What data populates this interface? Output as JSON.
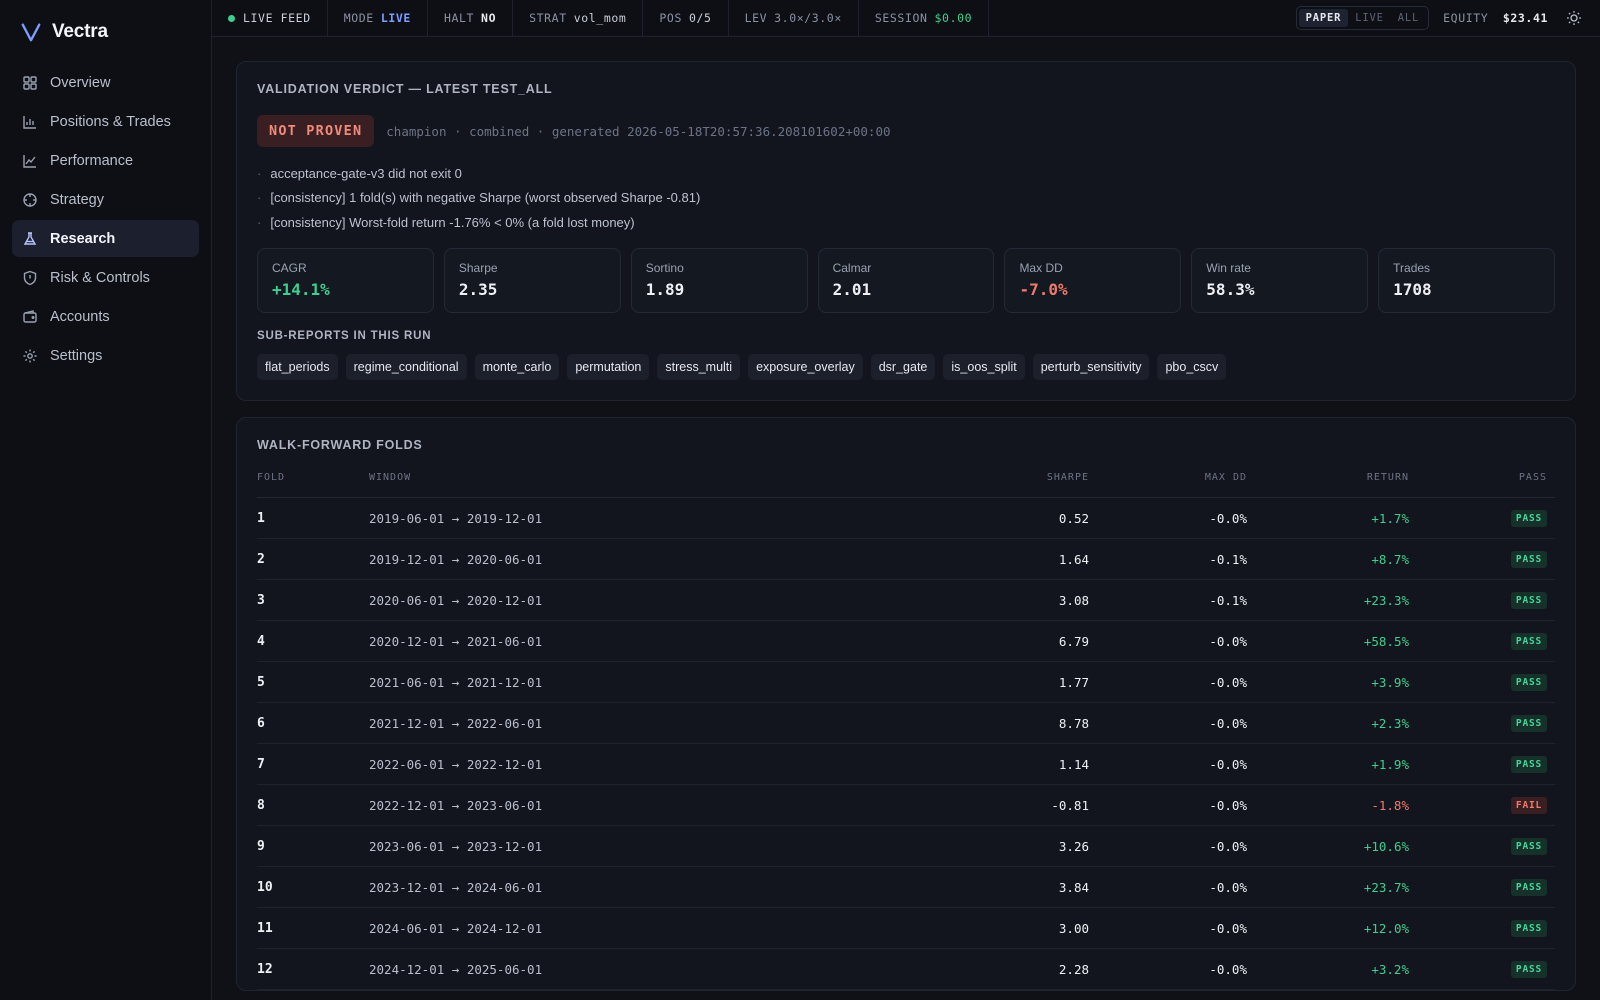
{
  "brand": {
    "name": "Vectra"
  },
  "sidebar": {
    "items": [
      {
        "label": "Overview",
        "icon": "grid-icon"
      },
      {
        "label": "Positions & Trades",
        "icon": "bar-chart-icon"
      },
      {
        "label": "Performance",
        "icon": "line-chart-icon"
      },
      {
        "label": "Strategy",
        "icon": "crosshair-icon"
      },
      {
        "label": "Research",
        "icon": "flask-icon",
        "active": true
      },
      {
        "label": "Risk & Controls",
        "icon": "shield-icon"
      },
      {
        "label": "Accounts",
        "icon": "wallet-icon"
      },
      {
        "label": "Settings",
        "icon": "gear-icon"
      }
    ]
  },
  "topbar": {
    "live_feed": "LIVE FEED",
    "mode_label": "MODE",
    "mode_value": "LIVE",
    "halt_label": "HALT",
    "halt_value": "NO",
    "strat_label": "STRAT",
    "strat_value": "vol_mom",
    "pos_label": "POS",
    "pos_value": "0/5",
    "lev_label": "LEV",
    "lev_value": "3.0×/3.0×",
    "session_label": "SESSION",
    "session_value": "$0.00",
    "toggle": [
      "PAPER",
      "LIVE",
      "ALL"
    ],
    "toggle_selected": "PAPER",
    "equity_label": "EQUITY",
    "equity_value": "$23.41"
  },
  "verdict": {
    "title": "VALIDATION VERDICT — LATEST TEST_ALL",
    "badge": "NOT PROVEN",
    "meta": "champion · combined · generated 2026-05-18T20:57:36.208101602+00:00",
    "reasons": [
      "acceptance-gate-v3 did not exit 0",
      "[consistency] 1 fold(s) with negative Sharpe (worst observed Sharpe -0.81)",
      "[consistency] Worst-fold return -1.76% < 0% (a fold lost money)"
    ],
    "metrics": [
      {
        "label": "CAGR",
        "value": "+14.1%",
        "tone": "pos"
      },
      {
        "label": "Sharpe",
        "value": "2.35",
        "tone": ""
      },
      {
        "label": "Sortino",
        "value": "1.89",
        "tone": ""
      },
      {
        "label": "Calmar",
        "value": "2.01",
        "tone": ""
      },
      {
        "label": "Max DD",
        "value": "-7.0%",
        "tone": "neg"
      },
      {
        "label": "Win rate",
        "value": "58.3%",
        "tone": ""
      },
      {
        "label": "Trades",
        "value": "1708",
        "tone": ""
      }
    ],
    "subreports_title": "SUB-REPORTS IN THIS RUN",
    "subreports": [
      "flat_periods",
      "regime_conditional",
      "monte_carlo",
      "permutation",
      "stress_multi",
      "exposure_overlay",
      "dsr_gate",
      "is_oos_split",
      "perturb_sensitivity",
      "pbo_cscv"
    ]
  },
  "folds": {
    "title": "WALK-FORWARD FOLDS",
    "columns": [
      "FOLD",
      "WINDOW",
      "SHARPE",
      "MAX DD",
      "RETURN",
      "PASS"
    ],
    "rows": [
      {
        "fold": "1",
        "window": "2019-06-01 → 2019-12-01",
        "sharpe": "0.52",
        "maxdd": "-0.0%",
        "ret": "+1.7%",
        "pass": "PASS"
      },
      {
        "fold": "2",
        "window": "2019-12-01 → 2020-06-01",
        "sharpe": "1.64",
        "maxdd": "-0.1%",
        "ret": "+8.7%",
        "pass": "PASS"
      },
      {
        "fold": "3",
        "window": "2020-06-01 → 2020-12-01",
        "sharpe": "3.08",
        "maxdd": "-0.1%",
        "ret": "+23.3%",
        "pass": "PASS"
      },
      {
        "fold": "4",
        "window": "2020-12-01 → 2021-06-01",
        "sharpe": "6.79",
        "maxdd": "-0.0%",
        "ret": "+58.5%",
        "pass": "PASS"
      },
      {
        "fold": "5",
        "window": "2021-06-01 → 2021-12-01",
        "sharpe": "1.77",
        "maxdd": "-0.0%",
        "ret": "+3.9%",
        "pass": "PASS"
      },
      {
        "fold": "6",
        "window": "2021-12-01 → 2022-06-01",
        "sharpe": "8.78",
        "maxdd": "-0.0%",
        "ret": "+2.3%",
        "pass": "PASS"
      },
      {
        "fold": "7",
        "window": "2022-06-01 → 2022-12-01",
        "sharpe": "1.14",
        "maxdd": "-0.0%",
        "ret": "+1.9%",
        "pass": "PASS"
      },
      {
        "fold": "8",
        "window": "2022-12-01 → 2023-06-01",
        "sharpe": "-0.81",
        "maxdd": "-0.0%",
        "ret": "-1.8%",
        "pass": "FAIL"
      },
      {
        "fold": "9",
        "window": "2023-06-01 → 2023-12-01",
        "sharpe": "3.26",
        "maxdd": "-0.0%",
        "ret": "+10.6%",
        "pass": "PASS"
      },
      {
        "fold": "10",
        "window": "2023-12-01 → 2024-06-01",
        "sharpe": "3.84",
        "maxdd": "-0.0%",
        "ret": "+23.7%",
        "pass": "PASS"
      },
      {
        "fold": "11",
        "window": "2024-06-01 → 2024-12-01",
        "sharpe": "3.00",
        "maxdd": "-0.0%",
        "ret": "+12.0%",
        "pass": "PASS"
      },
      {
        "fold": "12",
        "window": "2024-12-01 → 2025-06-01",
        "sharpe": "2.28",
        "maxdd": "-0.0%",
        "ret": "+3.2%",
        "pass": "PASS"
      }
    ]
  },
  "colors": {
    "accent": "#7c9cff",
    "positive": "#3ecf8e",
    "negative": "#f07a6a",
    "background": "#0f1117"
  }
}
